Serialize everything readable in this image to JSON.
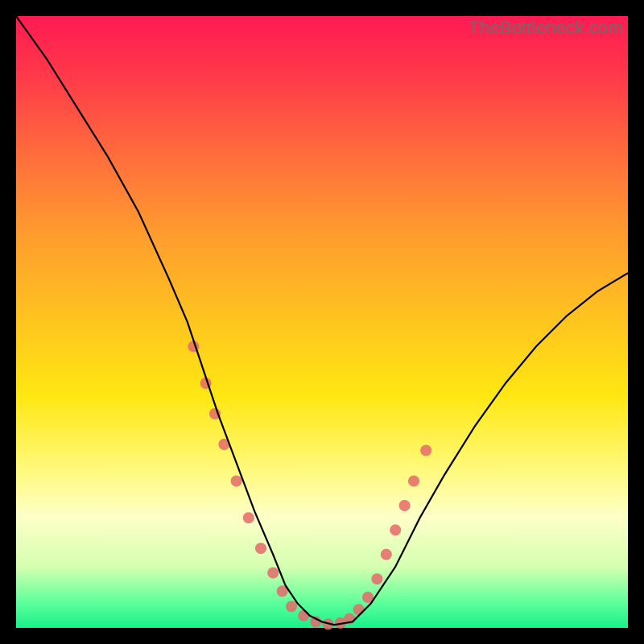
{
  "watermark": "TheBottleneck.com",
  "chart_data": {
    "type": "line",
    "title": "",
    "xlabel": "",
    "ylabel": "",
    "xlim": [
      0,
      100
    ],
    "ylim": [
      0,
      100
    ],
    "grid": false,
    "legend": false,
    "background_gradient": {
      "top": "#ff1a52",
      "mid": "#ffe712",
      "bottom": "#18f08a"
    },
    "series": [
      {
        "name": "bottleneck-curve",
        "color": "#000000",
        "x": [
          0,
          5,
          10,
          15,
          20,
          25,
          28,
          30,
          33,
          36,
          39,
          42,
          44,
          46,
          48,
          50,
          52,
          55,
          58,
          62,
          66,
          70,
          75,
          80,
          85,
          90,
          95,
          100
        ],
        "y": [
          100,
          93,
          85,
          77,
          68,
          57,
          50,
          44,
          35,
          27,
          19,
          12,
          7,
          4,
          2,
          1,
          0.5,
          1,
          4,
          10,
          18,
          25,
          33,
          40,
          46,
          51,
          55,
          58
        ]
      }
    ],
    "markers": [
      {
        "name": "highlighted-points",
        "color": "#e46a6a",
        "radius_px": 7,
        "points": [
          {
            "x": 29,
            "y": 46
          },
          {
            "x": 31,
            "y": 40
          },
          {
            "x": 32.5,
            "y": 35
          },
          {
            "x": 34,
            "y": 30
          },
          {
            "x": 36,
            "y": 24
          },
          {
            "x": 38,
            "y": 18
          },
          {
            "x": 40,
            "y": 13
          },
          {
            "x": 42,
            "y": 9
          },
          {
            "x": 43.5,
            "y": 6
          },
          {
            "x": 45,
            "y": 3.5
          },
          {
            "x": 47,
            "y": 2
          },
          {
            "x": 49,
            "y": 1
          },
          {
            "x": 51,
            "y": 0.6
          },
          {
            "x": 53,
            "y": 0.8
          },
          {
            "x": 54.5,
            "y": 1.5
          },
          {
            "x": 56,
            "y": 3
          },
          {
            "x": 57.5,
            "y": 5
          },
          {
            "x": 59,
            "y": 8
          },
          {
            "x": 60.5,
            "y": 12
          },
          {
            "x": 62,
            "y": 16
          },
          {
            "x": 63.5,
            "y": 20
          },
          {
            "x": 65,
            "y": 24
          },
          {
            "x": 67,
            "y": 29
          }
        ]
      }
    ]
  }
}
